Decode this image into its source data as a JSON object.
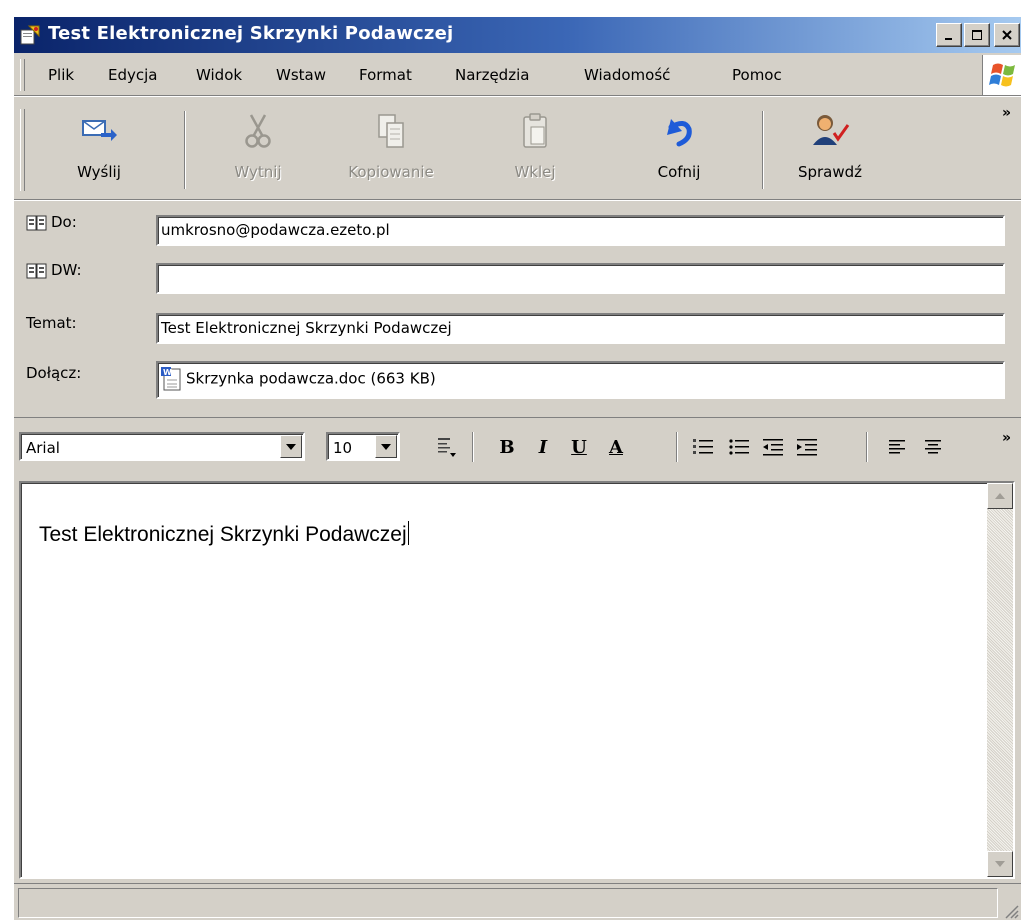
{
  "window": {
    "title": "Test Elektronicznej Skrzynki Podawczej"
  },
  "menu": [
    "Plik",
    "Edycja",
    "Widok",
    "Wstaw",
    "Format",
    "Narzędzia",
    "Wiadomość",
    "Pomoc"
  ],
  "toolbar": {
    "send": "Wyślij",
    "cut": "Wytnij",
    "copy": "Kopiowanie",
    "paste": "Wklej",
    "undo": "Cofnij",
    "check": "Sprawdź"
  },
  "header": {
    "to_label": "Do:",
    "to_value": "umkrosno@podawcza.ezeto.pl",
    "cc_label": "DW:",
    "cc_value": "",
    "subject_label": "Temat:",
    "subject_value": "Test Elektronicznej Skrzynki Podawczej",
    "attach_label": "Dołącz:",
    "attach_value": "Skrzynka podawcza.doc (663 KB)"
  },
  "format": {
    "font": "Arial",
    "size": "10",
    "bold": "B",
    "italic": "I",
    "underline": "U",
    "font_color": "A"
  },
  "body": {
    "text": "Test Elektronicznej Skrzynki Podawczej"
  },
  "colors": {
    "titlebar_start": "#0a246a",
    "titlebar_end": "#a6caf0",
    "chrome": "#d4d0c8"
  }
}
